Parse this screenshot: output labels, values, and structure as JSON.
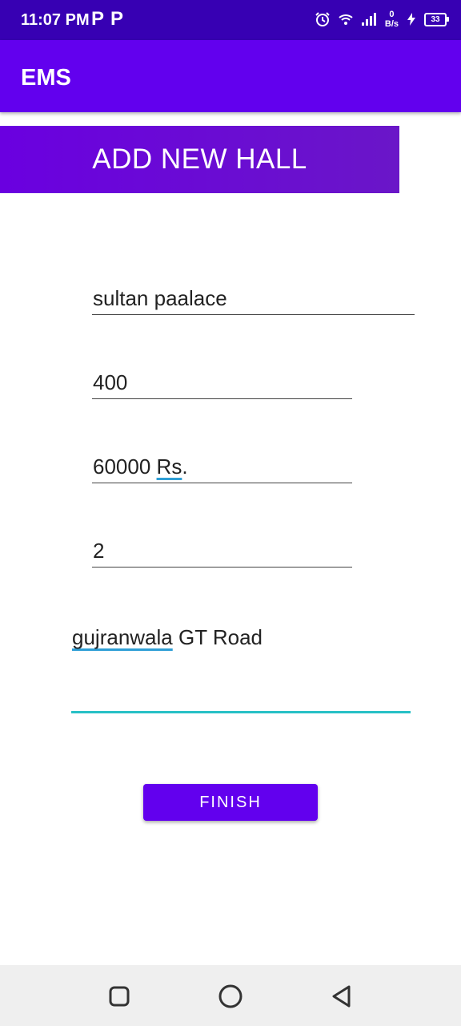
{
  "status_bar": {
    "time": "11:07 PM",
    "notif_p1": "P",
    "notif_p2": "P",
    "net_speed_value": "0",
    "net_speed_unit": "B/s",
    "battery_level": "33",
    "icons": [
      "alarm-icon",
      "wifi-icon",
      "signal-icon",
      "charging-icon",
      "battery-icon"
    ]
  },
  "app_bar": {
    "title": "EMS"
  },
  "header": {
    "title": "ADD NEW HALL"
  },
  "form": {
    "hall_name": "sultan paalace",
    "capacity": "400",
    "price_number": "60000",
    "price_unit": "Rs",
    "price_suffix": ".",
    "halls_count": "2",
    "address_city": "gujranwala",
    "address_rest": " GT Road"
  },
  "finish_button": {
    "label": "FINISH"
  },
  "nav_bar": {
    "icons": [
      "recent-apps-icon",
      "home-icon",
      "back-icon"
    ]
  },
  "colors": {
    "status_bar": "#3700b3",
    "app_bar": "#6200ee",
    "accent": "#27c0c6",
    "nav_bar": "#efefef"
  }
}
